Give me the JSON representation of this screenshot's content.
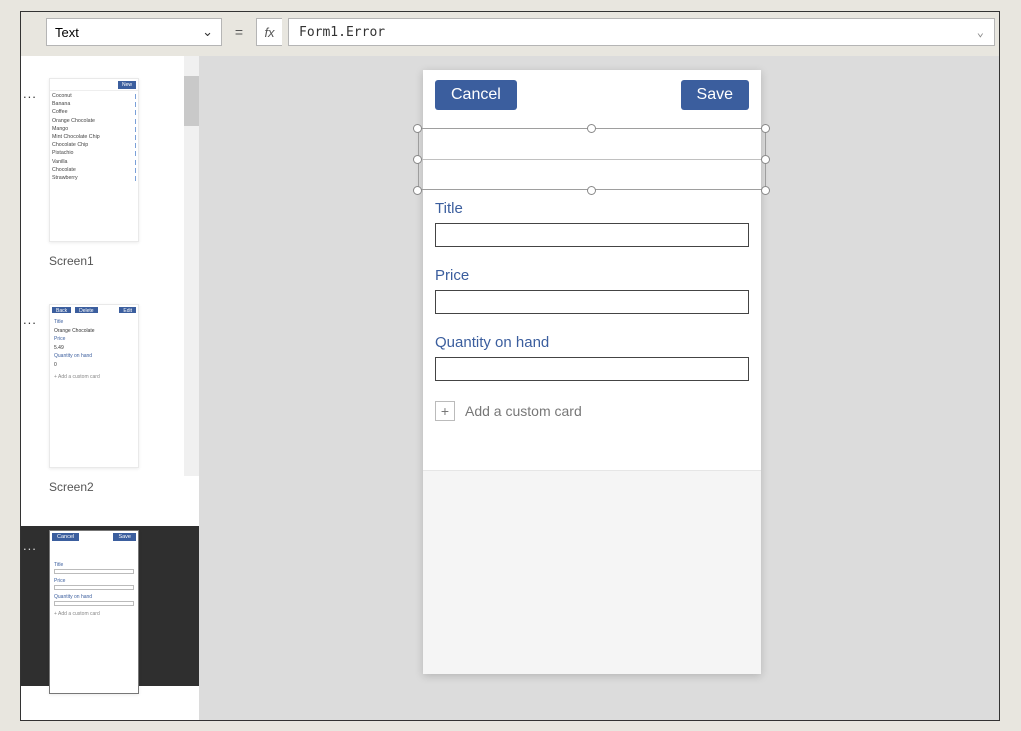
{
  "formula_bar": {
    "property": "Text",
    "equals": "=",
    "fx": "fx",
    "formula": "Form1.Error"
  },
  "screens": {
    "s1": {
      "label": "Screen1",
      "new_btn": "New",
      "items": [
        "Coconut",
        "Banana",
        "Coffee",
        "Orange Chocolate",
        "Mango",
        "Mint Chocolate Chip",
        "Chocolate Chip",
        "Pistachio",
        "Vanilla",
        "Chocolate",
        "Strawberry"
      ]
    },
    "s2": {
      "label": "Screen2",
      "back": "Back",
      "delete": "Delete",
      "edit": "Edit",
      "title_lbl": "Title",
      "title_val": "Orange Chocolate",
      "price_lbl": "Price",
      "price_val": "5.49",
      "qty_lbl": "Quantity on hand",
      "qty_val": "0",
      "add": "+  Add a custom card"
    },
    "s3": {
      "cancel": "Cancel",
      "save": "Save",
      "title_lbl": "Title",
      "price_lbl": "Price",
      "qty_lbl": "Quantity on hand",
      "add": "+  Add a custom card"
    }
  },
  "form": {
    "cancel": "Cancel",
    "save": "Save",
    "title_lbl": "Title",
    "price_lbl": "Price",
    "qty_lbl": "Quantity on hand",
    "add_card": "Add a custom card",
    "plus": "+"
  }
}
